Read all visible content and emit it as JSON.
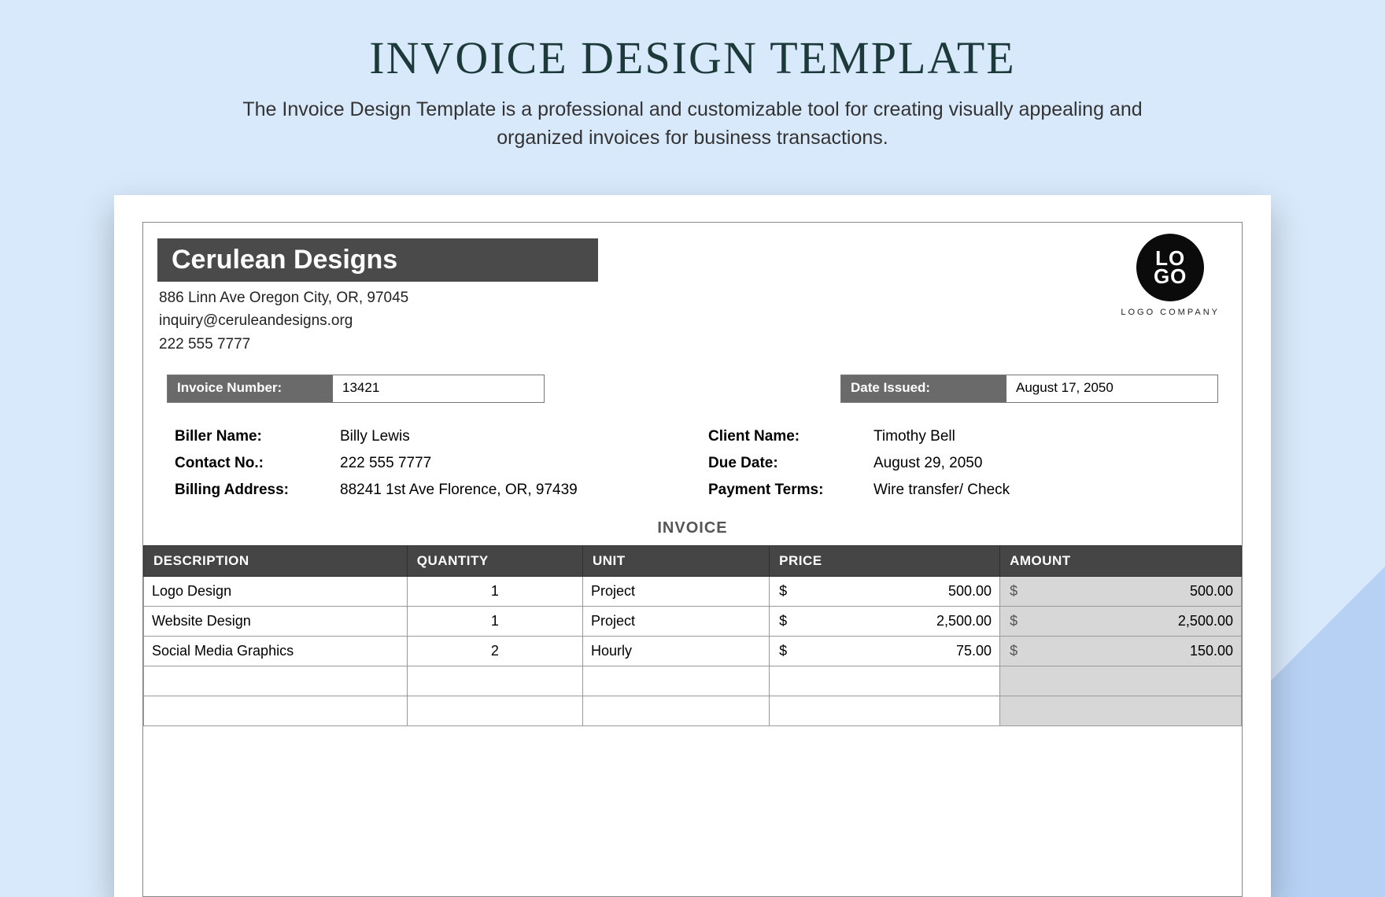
{
  "hero": {
    "title": "INVOICE DESIGN TEMPLATE",
    "subtitle": "The Invoice Design Template is a professional and customizable tool for creating visually appealing and organized invoices for business transactions."
  },
  "company": {
    "name": "Cerulean Designs",
    "address": "886 Linn Ave Oregon City, OR, 97045",
    "email": "inquiry@ceruleandesigns.org",
    "phone": "222 555 7777"
  },
  "logo": {
    "line1": "LO",
    "line2": "GO",
    "caption": "LOGO COMPANY"
  },
  "meta": {
    "invoice_number_label": "Invoice Number:",
    "invoice_number": "13421",
    "date_issued_label": "Date Issued:",
    "date_issued": "August 17, 2050"
  },
  "biller": {
    "name_label": "Biller Name:",
    "name": "Billy Lewis",
    "contact_label": "Contact No.:",
    "contact": "222 555 7777",
    "address_label": "Billing Address:",
    "address": "88241 1st Ave Florence, OR, 97439"
  },
  "client": {
    "name_label": "Client Name:",
    "name": "Timothy Bell",
    "due_label": "Due Date:",
    "due": "August 29, 2050",
    "terms_label": "Payment Terms:",
    "terms": "Wire transfer/ Check"
  },
  "section_title": "INVOICE",
  "columns": {
    "description": "DESCRIPTION",
    "quantity": "QUANTITY",
    "unit": "UNIT",
    "price": "PRICE",
    "amount": "AMOUNT"
  },
  "currency": "$",
  "items": [
    {
      "description": "Logo Design",
      "quantity": "1",
      "unit": "Project",
      "price": "500.00",
      "amount": "500.00"
    },
    {
      "description": "Website Design",
      "quantity": "1",
      "unit": "Project",
      "price": "2,500.00",
      "amount": "2,500.00"
    },
    {
      "description": "Social Media Graphics",
      "quantity": "2",
      "unit": "Hourly",
      "price": "75.00",
      "amount": "150.00"
    },
    {
      "description": "",
      "quantity": "",
      "unit": "",
      "price": "",
      "amount": ""
    },
    {
      "description": "",
      "quantity": "",
      "unit": "",
      "price": "",
      "amount": ""
    }
  ]
}
